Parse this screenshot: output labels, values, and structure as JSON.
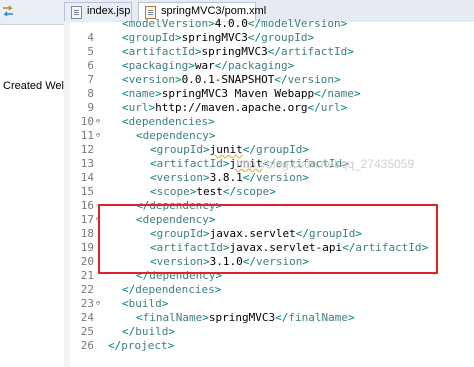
{
  "left_panel": {
    "created_label": "Created Wel"
  },
  "tabs": [
    {
      "label": "index.jsp",
      "active": false
    },
    {
      "label": "springMVC3/pom.xml",
      "active": true
    }
  ],
  "watermark": "http://blog.csdn.net/qq_27435059",
  "lines": [
    {
      "num": "",
      "indent": 1,
      "open": "modelVersion",
      "text": "4.0.0",
      "close": "modelVersion",
      "fold": ""
    },
    {
      "num": "4",
      "indent": 1,
      "open": "groupId",
      "text": "springMVC3",
      "close": "groupId",
      "fold": ""
    },
    {
      "num": "5",
      "indent": 1,
      "open": "artifactId",
      "text": "springMVC3",
      "close": "artifactId",
      "fold": ""
    },
    {
      "num": "6",
      "indent": 1,
      "open": "packaging",
      "text": "war",
      "close": "packaging",
      "fold": ""
    },
    {
      "num": "7",
      "indent": 1,
      "open": "version",
      "text": "0.0.1-SNAPSHOT",
      "close": "version",
      "fold": ""
    },
    {
      "num": "8",
      "indent": 1,
      "open": "name",
      "text": "springMVC3 Maven Webapp",
      "close": "name",
      "fold": ""
    },
    {
      "num": "9",
      "indent": 1,
      "open": "url",
      "text": "http://maven.apache.org",
      "close": "url",
      "fold": ""
    },
    {
      "num": "10",
      "indent": 1,
      "open": "dependencies",
      "text": "",
      "close": "",
      "fold": "⊖"
    },
    {
      "num": "11",
      "indent": 2,
      "open": "dependency",
      "text": "",
      "close": "",
      "fold": "⊖"
    },
    {
      "num": "12",
      "indent": 3,
      "open": "groupId",
      "text": "junit",
      "close": "groupId",
      "fold": ""
    },
    {
      "num": "13",
      "indent": 3,
      "open": "artifactId",
      "text": "junit",
      "close": "artifactId",
      "fold": ""
    },
    {
      "num": "14",
      "indent": 3,
      "open": "version",
      "text": "3.8.1",
      "close": "version",
      "fold": ""
    },
    {
      "num": "15",
      "indent": 3,
      "open": "scope",
      "text": "test",
      "close": "scope",
      "fold": ""
    },
    {
      "num": "16",
      "indent": 2,
      "open": "",
      "text": "",
      "close": "dependency",
      "fold": ""
    },
    {
      "num": "17",
      "indent": 2,
      "open": "dependency",
      "text": "",
      "close": "",
      "fold": "⊖"
    },
    {
      "num": "18",
      "indent": 3,
      "open": "groupId",
      "text": "javax.servlet",
      "close": "groupId",
      "fold": ""
    },
    {
      "num": "19",
      "indent": 3,
      "open": "artifactId",
      "text": "javax.servlet-api",
      "close": "artifactId",
      "fold": ""
    },
    {
      "num": "20",
      "indent": 3,
      "open": "version",
      "text": "3.1.0",
      "close": "version",
      "fold": ""
    },
    {
      "num": "21",
      "indent": 2,
      "open": "",
      "text": "",
      "close": "dependency",
      "fold": ""
    },
    {
      "num": "22",
      "indent": 1,
      "open": "",
      "text": "",
      "close": "dependencies",
      "fold": ""
    },
    {
      "num": "23",
      "indent": 1,
      "open": "build",
      "text": "",
      "close": "",
      "fold": "⊖"
    },
    {
      "num": "24",
      "indent": 2,
      "open": "finalName",
      "text": "springMVC3",
      "close": "finalName",
      "fold": ""
    },
    {
      "num": "25",
      "indent": 1,
      "open": "",
      "text": "",
      "close": "build",
      "fold": ""
    },
    {
      "num": "26",
      "indent": 0,
      "open": "",
      "text": "",
      "close": "project",
      "fold": ""
    }
  ],
  "colors": {
    "tag": "#3f7f7f",
    "bracket": "#008080",
    "highlight": "#e0202a",
    "line_number": "#787878"
  }
}
